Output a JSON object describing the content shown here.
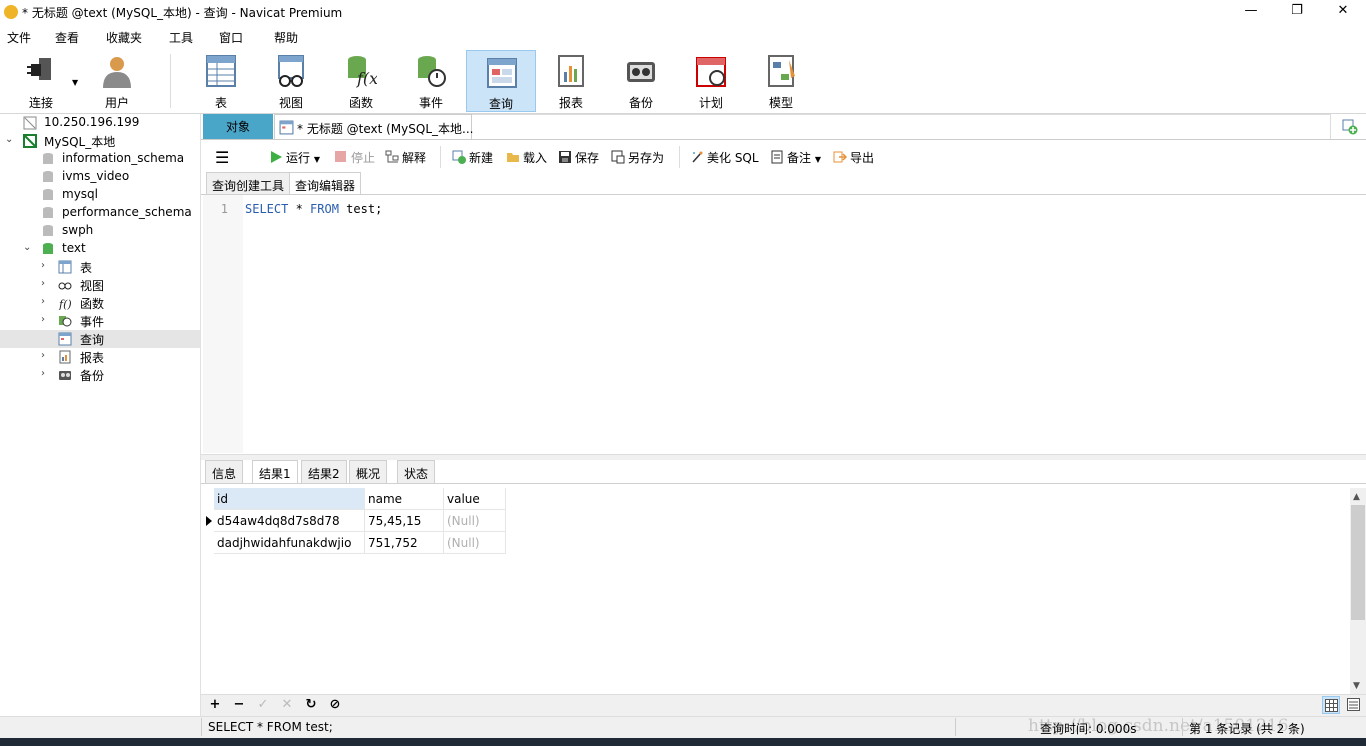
{
  "window": {
    "title": "* 无标题 @text (MySQL_本地) - 查询 - Navicat Premium",
    "minimize": "—",
    "maximize": "❐",
    "close": "✕"
  },
  "menu": [
    "文件",
    "查看",
    "收藏夹",
    "工具",
    "窗口",
    "帮助"
  ],
  "toolbar": {
    "connect": "连接",
    "user": "用户",
    "items": [
      "表",
      "视图",
      "函数",
      "事件",
      "查询",
      "报表",
      "备份",
      "计划",
      "模型"
    ],
    "active": "查询"
  },
  "tree": {
    "server": "10.250.196.199",
    "connection": "MySQL_本地",
    "databases": [
      "information_schema",
      "ivms_video",
      "mysql",
      "performance_schema",
      "swph",
      "text"
    ],
    "text_children": [
      "表",
      "视图",
      "函数",
      "事件",
      "查询",
      "报表",
      "备份"
    ]
  },
  "tabs": {
    "object": "对象",
    "query": "* 无标题 @text (MySQL_本地..."
  },
  "query_toolbar": {
    "run": "运行",
    "stop": "停止",
    "explain": "解释",
    "new": "新建",
    "load": "载入",
    "save": "保存",
    "save_as": "另存为",
    "beautify": "美化 SQL",
    "comment": "备注",
    "export": "导出"
  },
  "subtabs": [
    "查询创建工具",
    "查询编辑器"
  ],
  "editor": {
    "line_no": "1",
    "kw1": "SELECT",
    "mid": " * ",
    "kw2": "FROM",
    "rest": " test;"
  },
  "result_tabs": [
    "信息",
    "结果1",
    "结果2",
    "概况",
    "状态"
  ],
  "grid": {
    "columns": [
      "id",
      "name",
      "value"
    ],
    "rows": [
      [
        "d54aw4dq8d7s8d78",
        "75,45,15",
        "(Null)"
      ],
      [
        "dadjhwidahfunakdwjio",
        "751,752",
        "(Null)"
      ]
    ]
  },
  "gridbar": {
    "add": "+",
    "remove": "−",
    "apply": "✓",
    "discard": "✕",
    "refresh": "↻",
    "stop": "⊘"
  },
  "status": {
    "sql": "SELECT * FROM test;",
    "time": "查询时间: 0.000s",
    "records": "第 1 条记录 (共 2 条)",
    "watermark": "http://blog.csdn.net/a1501216"
  },
  "colors": {
    "object_tab": "#4aa6c8",
    "active_toolbar": "#cce4f7",
    "keyword": "#2a5db0"
  }
}
